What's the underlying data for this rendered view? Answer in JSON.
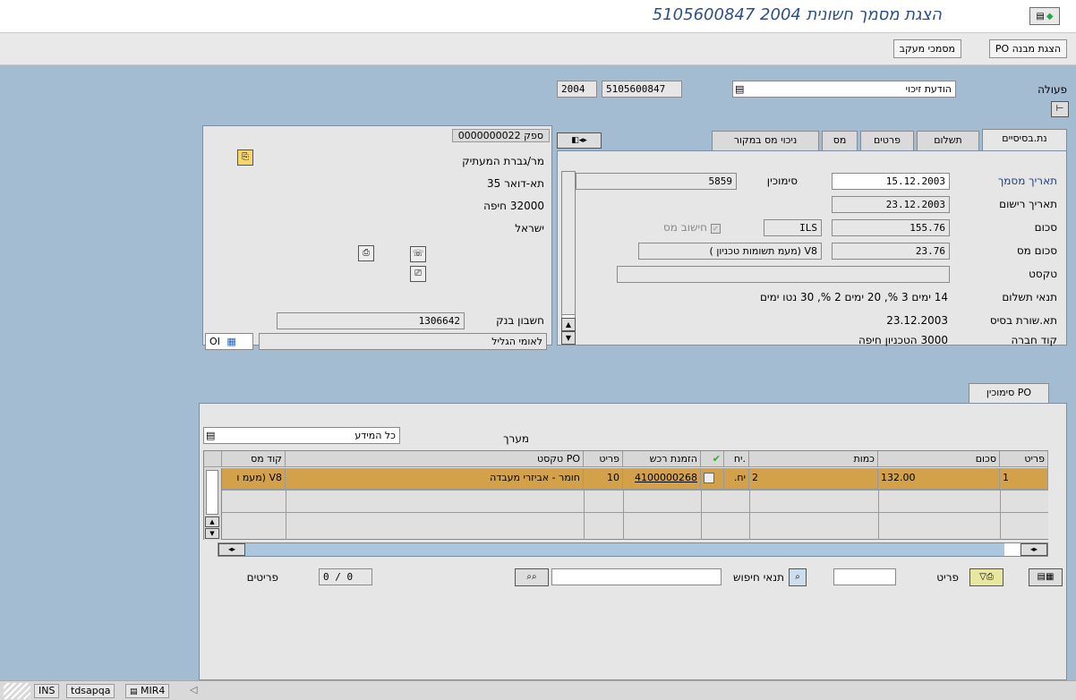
{
  "window": {
    "title": "הצגת מסמך חשונית 2004 5105600847"
  },
  "appbar": {
    "btn_po_structure": "הצגת מבנה PO",
    "btn_docs": "מסמכי מעקב"
  },
  "action": {
    "label": "פעולה",
    "value": "הודעת זיכוי",
    "doc_number": "5105600847",
    "year": "2004"
  },
  "tabs": [
    "נת.בסיסיים",
    "תשלום",
    "פרטים",
    "מס",
    "ניכוי מס במקור"
  ],
  "basic": {
    "doc_date_label": "תאריך מסמך",
    "doc_date": "15.12.2003",
    "ref_label": "סימוכין",
    "ref": "5859",
    "post_date_label": "תאריך רישום",
    "post_date": "23.12.2003",
    "amount_label": "סכום",
    "amount": "155.76",
    "currency": "ILS",
    "calc_tax_label": "חישוב מס",
    "tax_amount_label": "סכום מס",
    "tax_amount": "23.76",
    "tax_code": "V8 (מעמ תשומות טכניון )",
    "text_label": "טקסט",
    "text": "",
    "pay_terms_label": "תנאי תשלום",
    "pay_terms": "14 ימים 3 %, 20 ימים 2 %, 30 נטו ימים",
    "baseline_label": "תא.שורת בסיס",
    "baseline": "23.12.2003",
    "company_label": "קוד חברה",
    "company": "3000 הטכניון חיפה"
  },
  "vendor": {
    "header": "ספק 0000000022",
    "name": "מר/גברת המעתיק",
    "pobox": "תא-דואר 35",
    "city": "32000 חיפה",
    "country": "ישראל",
    "bank_label": "חשבון בנק",
    "bank": "1306642",
    "bank_name": "לאומי הגליל",
    "oi_label": "OI"
  },
  "po_tab": {
    "label": "PO סימוכין"
  },
  "items": {
    "layout_label": "מערך",
    "layout_value": "כל המידע",
    "columns": [
      "פריט",
      "סכום",
      "כמות",
      "יח.",
      "",
      "הזמנת רכש",
      "פריט",
      "טקסט PO",
      "קוד מס"
    ],
    "rows": [
      {
        "item": "1",
        "amount": "132.00",
        "qty": "2",
        "unit": "יח.",
        "po": "4100000268",
        "po_item": "10",
        "text": "חומר - אביזרי מעבדה",
        "tax": "V8 (מעמ ו"
      }
    ]
  },
  "footer": {
    "item_label": "פריט",
    "search_label": "תנאי חיפוש",
    "items_label": "פריטים",
    "count": "0 / 0"
  },
  "status": {
    "mode": "INS",
    "server": "tdsapqa",
    "tcode": "MIR4"
  }
}
